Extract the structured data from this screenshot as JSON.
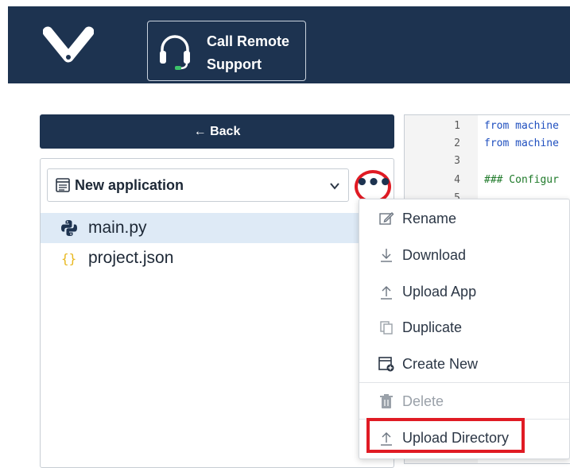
{
  "header": {
    "support_label": "Call Remote Support",
    "support_line1": "Call Remote",
    "support_line2": "Support"
  },
  "sidebar": {
    "back_label": "← Back",
    "app_selector_value": "New application",
    "files": [
      {
        "name": "main.py",
        "icon": "python-icon",
        "selected": true
      },
      {
        "name": "project.json",
        "icon": "json-braces-icon",
        "selected": false
      }
    ]
  },
  "editor": {
    "lines": [
      {
        "num": "1",
        "text": "from machine"
      },
      {
        "num": "2",
        "text": "from machine"
      },
      {
        "num": "3",
        "text": ""
      },
      {
        "num": "4",
        "text": "### Configur"
      },
      {
        "num": "5",
        "text": ""
      }
    ]
  },
  "context_menu": {
    "items": [
      {
        "label": "Rename",
        "icon": "edit-icon",
        "disabled": false
      },
      {
        "label": "Download",
        "icon": "download-icon",
        "disabled": false
      },
      {
        "label": "Upload App",
        "icon": "upload-icon",
        "disabled": false
      },
      {
        "label": "Duplicate",
        "icon": "duplicate-icon",
        "disabled": false
      },
      {
        "label": "Create New",
        "icon": "create-new-icon",
        "disabled": false
      },
      {
        "label": "Delete",
        "icon": "trash-icon",
        "disabled": true
      },
      {
        "label": "Upload Directory",
        "icon": "upload-icon",
        "disabled": false
      }
    ]
  },
  "colors": {
    "header_bg": "#1d3350",
    "highlight_red": "#e01b24",
    "selected_row": "#deeaf6"
  }
}
